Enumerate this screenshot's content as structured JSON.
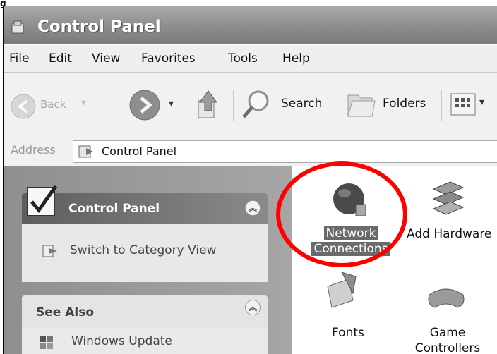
{
  "page": {
    "corner_mark": "g"
  },
  "window": {
    "title": "Control Panel"
  },
  "menu": [
    "File",
    "Edit",
    "View",
    "Favorites",
    "Tools",
    "Help"
  ],
  "toolbar": {
    "back_label": "Back",
    "search_label": "Search",
    "folders_label": "Folders"
  },
  "address": {
    "label": "Address",
    "value": "Control Panel"
  },
  "left_pane": {
    "control_panel_header": "Control Panel",
    "switch_view_link": "Switch to Category View",
    "see_also_header": "See Also",
    "windows_update_link": "Windows Update"
  },
  "items": {
    "network_connections": {
      "line1": "Network",
      "line2": "Connections"
    },
    "add_hardware": {
      "label": "Add Hardware"
    },
    "fonts": {
      "label": "Fonts"
    },
    "game_controllers": {
      "line1": "Game",
      "line2": "Controllers"
    }
  },
  "colors": {
    "highlight": "#ff0000"
  },
  "icons": [
    "app-folder-icon",
    "back-arrow-icon",
    "forward-arrow-icon",
    "up-folder-icon",
    "search-magnifier-icon",
    "folders-icon",
    "views-icon",
    "address-folder-icon",
    "control-panel-check-icon",
    "switch-view-icon",
    "collapse-chevron-icon",
    "windows-update-icon",
    "network-globe-icon",
    "hardware-icon",
    "fonts-icon",
    "game-controller-icon"
  ]
}
